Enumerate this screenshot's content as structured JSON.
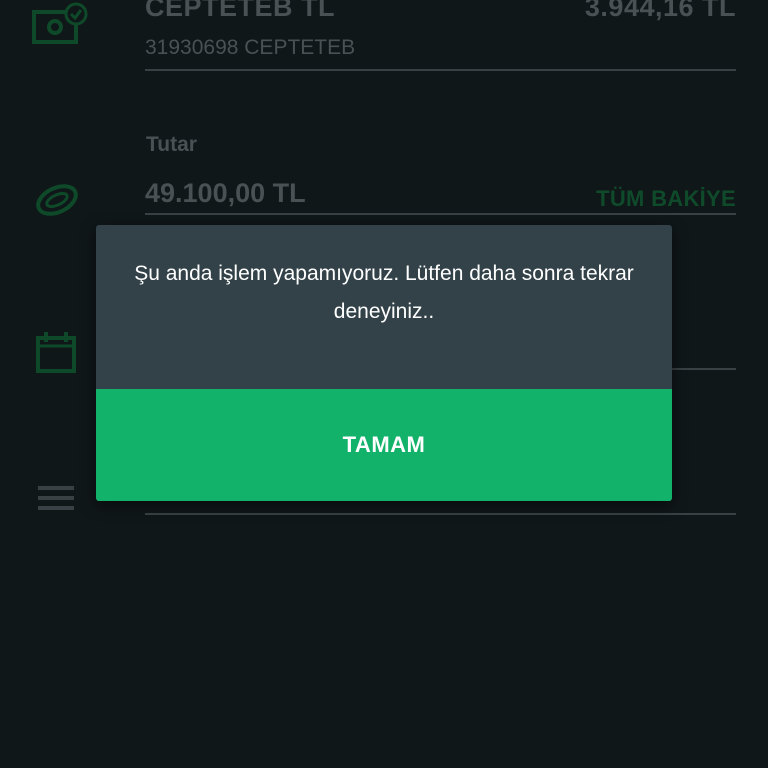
{
  "account": {
    "name": "CEPTETEB TL",
    "balance": "3.944,16 TL",
    "number": "31930698 CEPTETEB"
  },
  "amount": {
    "label": "Tutar",
    "value": "49.100,00 TL",
    "all_balance_label": "TÜM BAKİYE"
  },
  "icons": {
    "account": "money-check-icon",
    "amount": "coin-icon",
    "date": "calendar-icon",
    "description": "menu-lines-icon"
  },
  "dialog": {
    "message": "Şu anda işlem yapamıyoruz. Lütfen daha sonra tekrar deneyiniz..",
    "button_label": "TAMAM"
  },
  "colors": {
    "background": "#101719",
    "dialog": "#334249",
    "accent": "#13b26b",
    "dim_accent": "#0f4a2b"
  }
}
